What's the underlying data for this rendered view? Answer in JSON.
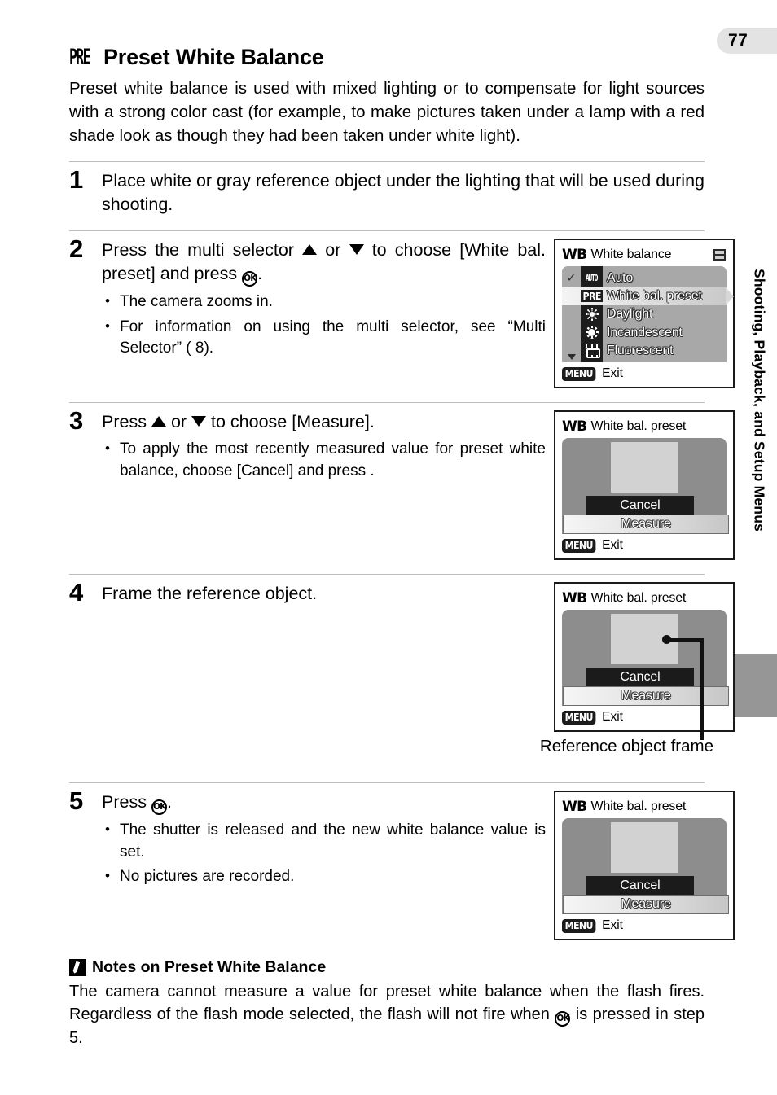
{
  "sidebar": {
    "page_number": "77",
    "section_label": "Shooting, Playback, and Setup Menus"
  },
  "header": {
    "icon": "pre-glyph",
    "icon_text": "PRE",
    "title": "Preset White Balance"
  },
  "intro": "Preset white balance is used with mixed lighting or to compensate for light sources with a strong color cast (for example, to make pictures taken under a lamp with a red shade look as though they had been taken under white light).",
  "steps": [
    {
      "number": "1",
      "lead": "Place white or gray reference object under the lighting that will be used during shooting.",
      "bullets": []
    },
    {
      "number": "2",
      "lead_parts": {
        "a": "Press the multi selector",
        "b": "or",
        "c": "to choose [White bal. preset] and press",
        "d": "."
      },
      "bullets": [
        "The camera zooms in.",
        "For information on using the multi selector, see “Multi Selector” (    8)."
      ]
    },
    {
      "number": "3",
      "lead_parts": {
        "a": "Press",
        "b": "or",
        "c": "to choose [Measure]."
      },
      "bullets": [
        "To apply the most recently measured value for preset white balance, choose [Cancel] and press    ."
      ]
    },
    {
      "number": "4",
      "lead": "Frame the reference object.",
      "bullets": []
    },
    {
      "number": "5",
      "lead_parts": {
        "a": "Press",
        "d": "."
      },
      "bullets": [
        "The shutter is released and the new white balance value is set.",
        "No pictures are recorded."
      ]
    }
  ],
  "screens": {
    "white_balance": {
      "wb_mark": "WB",
      "title": "White balance",
      "corner_icon": "window-icon",
      "items": [
        {
          "icon": "auto-icon",
          "icon_text": "AUTO",
          "label": "Auto",
          "checked": true,
          "selected": false
        },
        {
          "icon": "pre-icon",
          "icon_text": "PRE",
          "label": "White bal. preset",
          "checked": false,
          "selected": true
        },
        {
          "icon": "sun-icon",
          "icon_text": "",
          "label": "Daylight",
          "checked": false,
          "selected": false
        },
        {
          "icon": "lightbulb-icon",
          "icon_text": "",
          "label": "Incandescent",
          "checked": false,
          "selected": false
        },
        {
          "icon": "fluorescent-icon",
          "icon_text": "",
          "label": "Fluorescent",
          "checked": false,
          "selected": false
        }
      ],
      "check_glyph": "✓",
      "footer_badge": "MENU",
      "footer_label": "Exit"
    },
    "measure": {
      "wb_mark": "WB",
      "title": "White bal. preset",
      "cancel_label": "Cancel",
      "measure_label": "Measure",
      "footer_badge": "MENU",
      "footer_label": "Exit"
    },
    "callout": {
      "label": "Reference object frame"
    }
  },
  "note": {
    "icon": "pencil-icon",
    "title": "Notes on Preset White Balance",
    "body_a": "The camera cannot measure a value for preset white balance when the flash fires. Regardless of the flash mode selected, the flash will not fire when",
    "body_b": "is pressed in step 5."
  },
  "colors": {
    "page_pill_bg": "#e3e3e3",
    "side_tab_bg": "#969696",
    "screen_border": "#1a1a1a",
    "menu_panel_bg": "#a8a8a8",
    "icon_strip_bg": "#1c1c1c",
    "measure_panel_bg": "#8d8d8d",
    "ref_box_bg": "#d2d2d2",
    "dark_button_bg": "#1b1b1b",
    "separator": "#bdbdbd"
  }
}
